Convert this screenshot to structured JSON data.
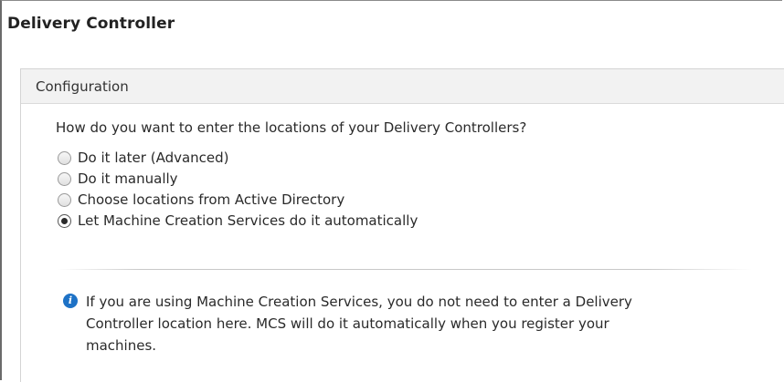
{
  "header": {
    "title": "Delivery Controller"
  },
  "section": {
    "title": "Configuration",
    "question": "How do you want to enter the locations of your Delivery Controllers?",
    "options": [
      {
        "label": "Do it later (Advanced)",
        "selected": false
      },
      {
        "label": "Do it manually",
        "selected": false
      },
      {
        "label": "Choose locations from Active Directory",
        "selected": false
      },
      {
        "label": "Let Machine Creation Services do it automatically",
        "selected": true
      }
    ]
  },
  "info": {
    "icon": "info-icon",
    "icon_glyph": "i",
    "icon_color": "#1e72c6",
    "lines": [
      "If you are using Machine Creation Services, you do not need to enter a Delivery",
      "Controller location here. MCS will do it automatically when you register your",
      "machines."
    ]
  }
}
